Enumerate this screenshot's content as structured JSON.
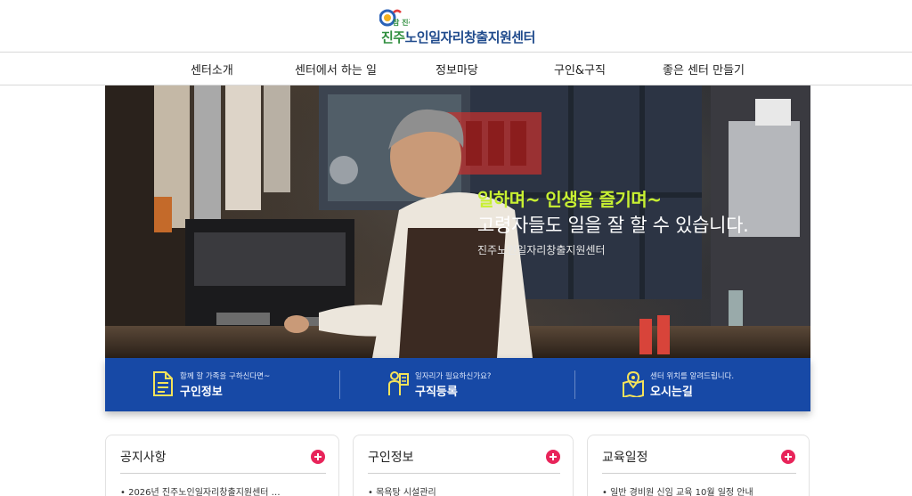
{
  "header": {
    "logo_emblem_text": "참 진주",
    "logo_prefix": "진주",
    "logo_name": "노인일자리창출지원센터"
  },
  "nav": {
    "items": [
      {
        "label": "센터소개"
      },
      {
        "label": "센터에서 하는 일"
      },
      {
        "label": "정보마당"
      },
      {
        "label": "구인&구직"
      },
      {
        "label": "좋은 센터 만들기"
      }
    ]
  },
  "hero": {
    "headline_accent": "일하며~ 인생을 즐기며~",
    "headline": "고령자들도 일을 잘 할 수 있습니다.",
    "org_name": "진주노인일자리창출지원센터"
  },
  "quick_links": [
    {
      "sub": "함께 할 가족을 구하신다면~",
      "label": "구인정보",
      "icon": "document-icon"
    },
    {
      "sub": "일자리가 필요하신가요?",
      "label": "구직등록",
      "icon": "job-seeker-icon"
    },
    {
      "sub": "센터 위치를 알려드립니다.",
      "label": "오시는길",
      "icon": "map-pin-icon"
    }
  ],
  "boards": [
    {
      "title": "공지사항",
      "first_item": "• 2026년 진주노인일자리창출지원센터 …"
    },
    {
      "title": "구인정보",
      "first_item": "• 목욕탕 시설관리"
    },
    {
      "title": "교육일정",
      "first_item": "• 일반 경비원 신임 교육 10월 일정 안내"
    }
  ],
  "colors": {
    "brand_blue": "#1749a6",
    "logo_blue": "#1f4a8c",
    "hero_accent": "#c8f032",
    "more_button": "#e8245a"
  }
}
